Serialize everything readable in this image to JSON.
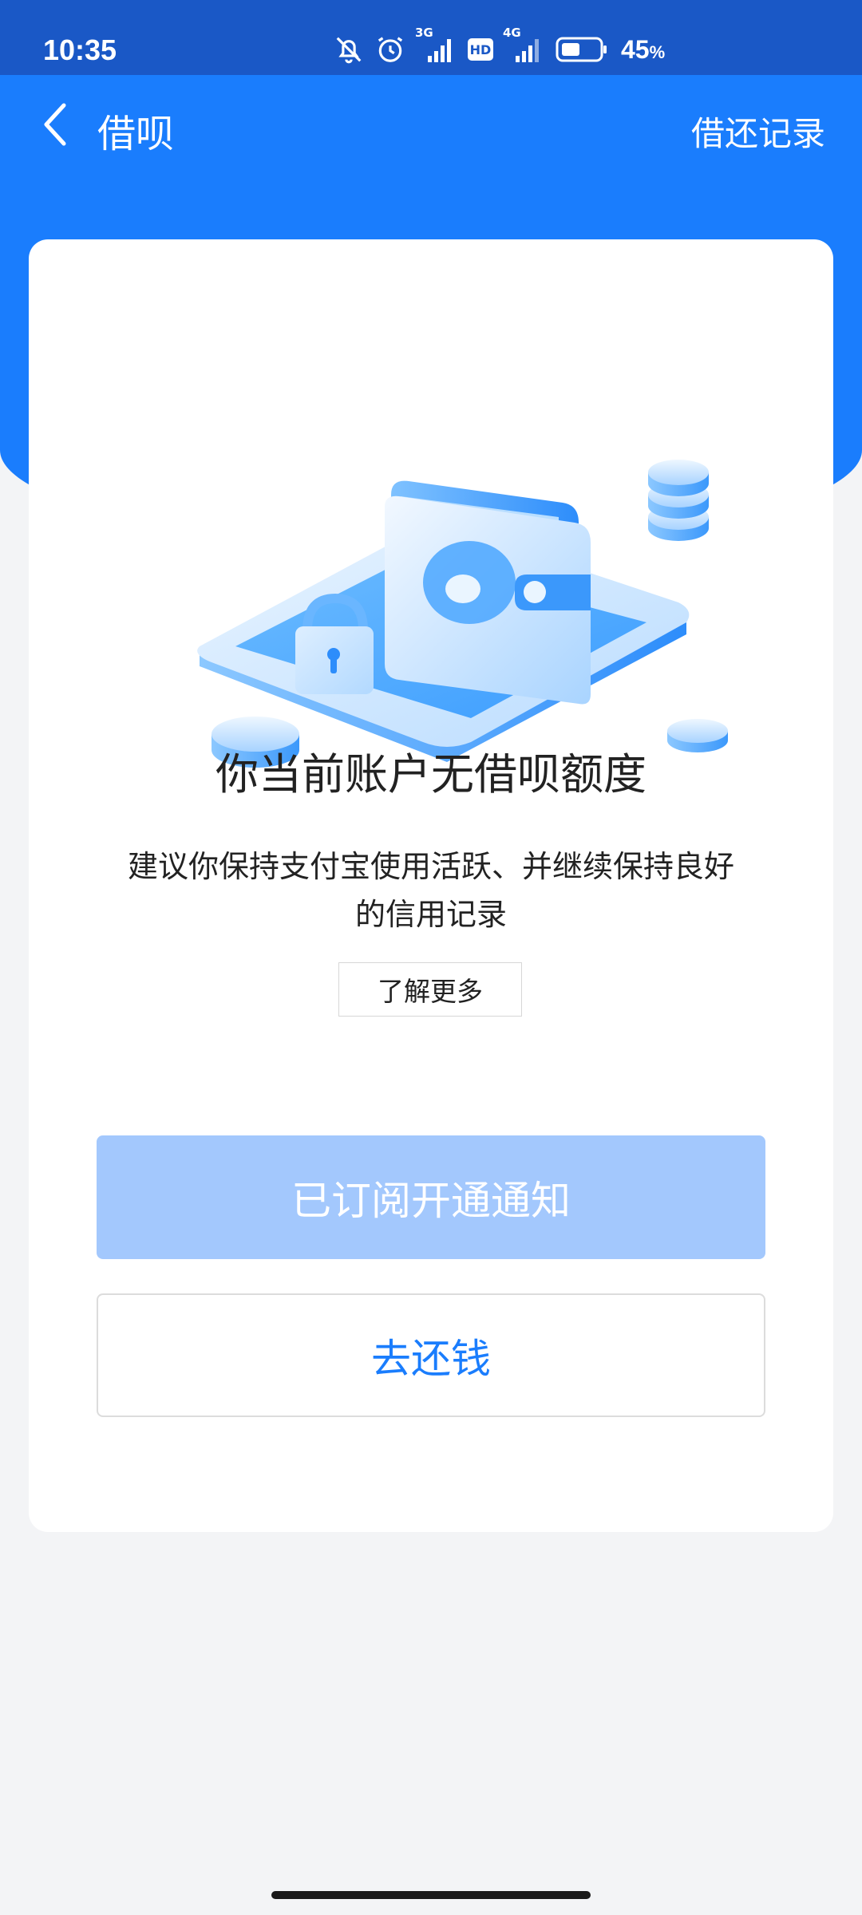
{
  "status_bar": {
    "time": "10:35",
    "network_3g": "3G",
    "hd": "HD",
    "network_4g": "4G",
    "battery_percent": "45",
    "battery_unit": "%",
    "icons": [
      "bell-off-icon",
      "alarm-icon",
      "signal-icon",
      "hd-icon",
      "signal-icon",
      "battery-icon"
    ]
  },
  "nav": {
    "back_icon": "chevron-left-icon",
    "title": "借呗",
    "right_link": "借还记录"
  },
  "main": {
    "illustration": "wallet-lock-coins-illustration",
    "headline": "你当前账户无借呗额度",
    "description": "建议你保持支付宝使用活跃、并继续保持良好的信用记录",
    "learn_more": "了解更多",
    "subscribed_button": "已订阅开通通知",
    "repay_button": "去还钱"
  },
  "colors": {
    "status_bar": "#1a58c6",
    "header": "#1a7dfd",
    "accent": "#1a7dfd",
    "disabled_button": "#a3c8fd",
    "page_bg": "#f3f4f6"
  }
}
